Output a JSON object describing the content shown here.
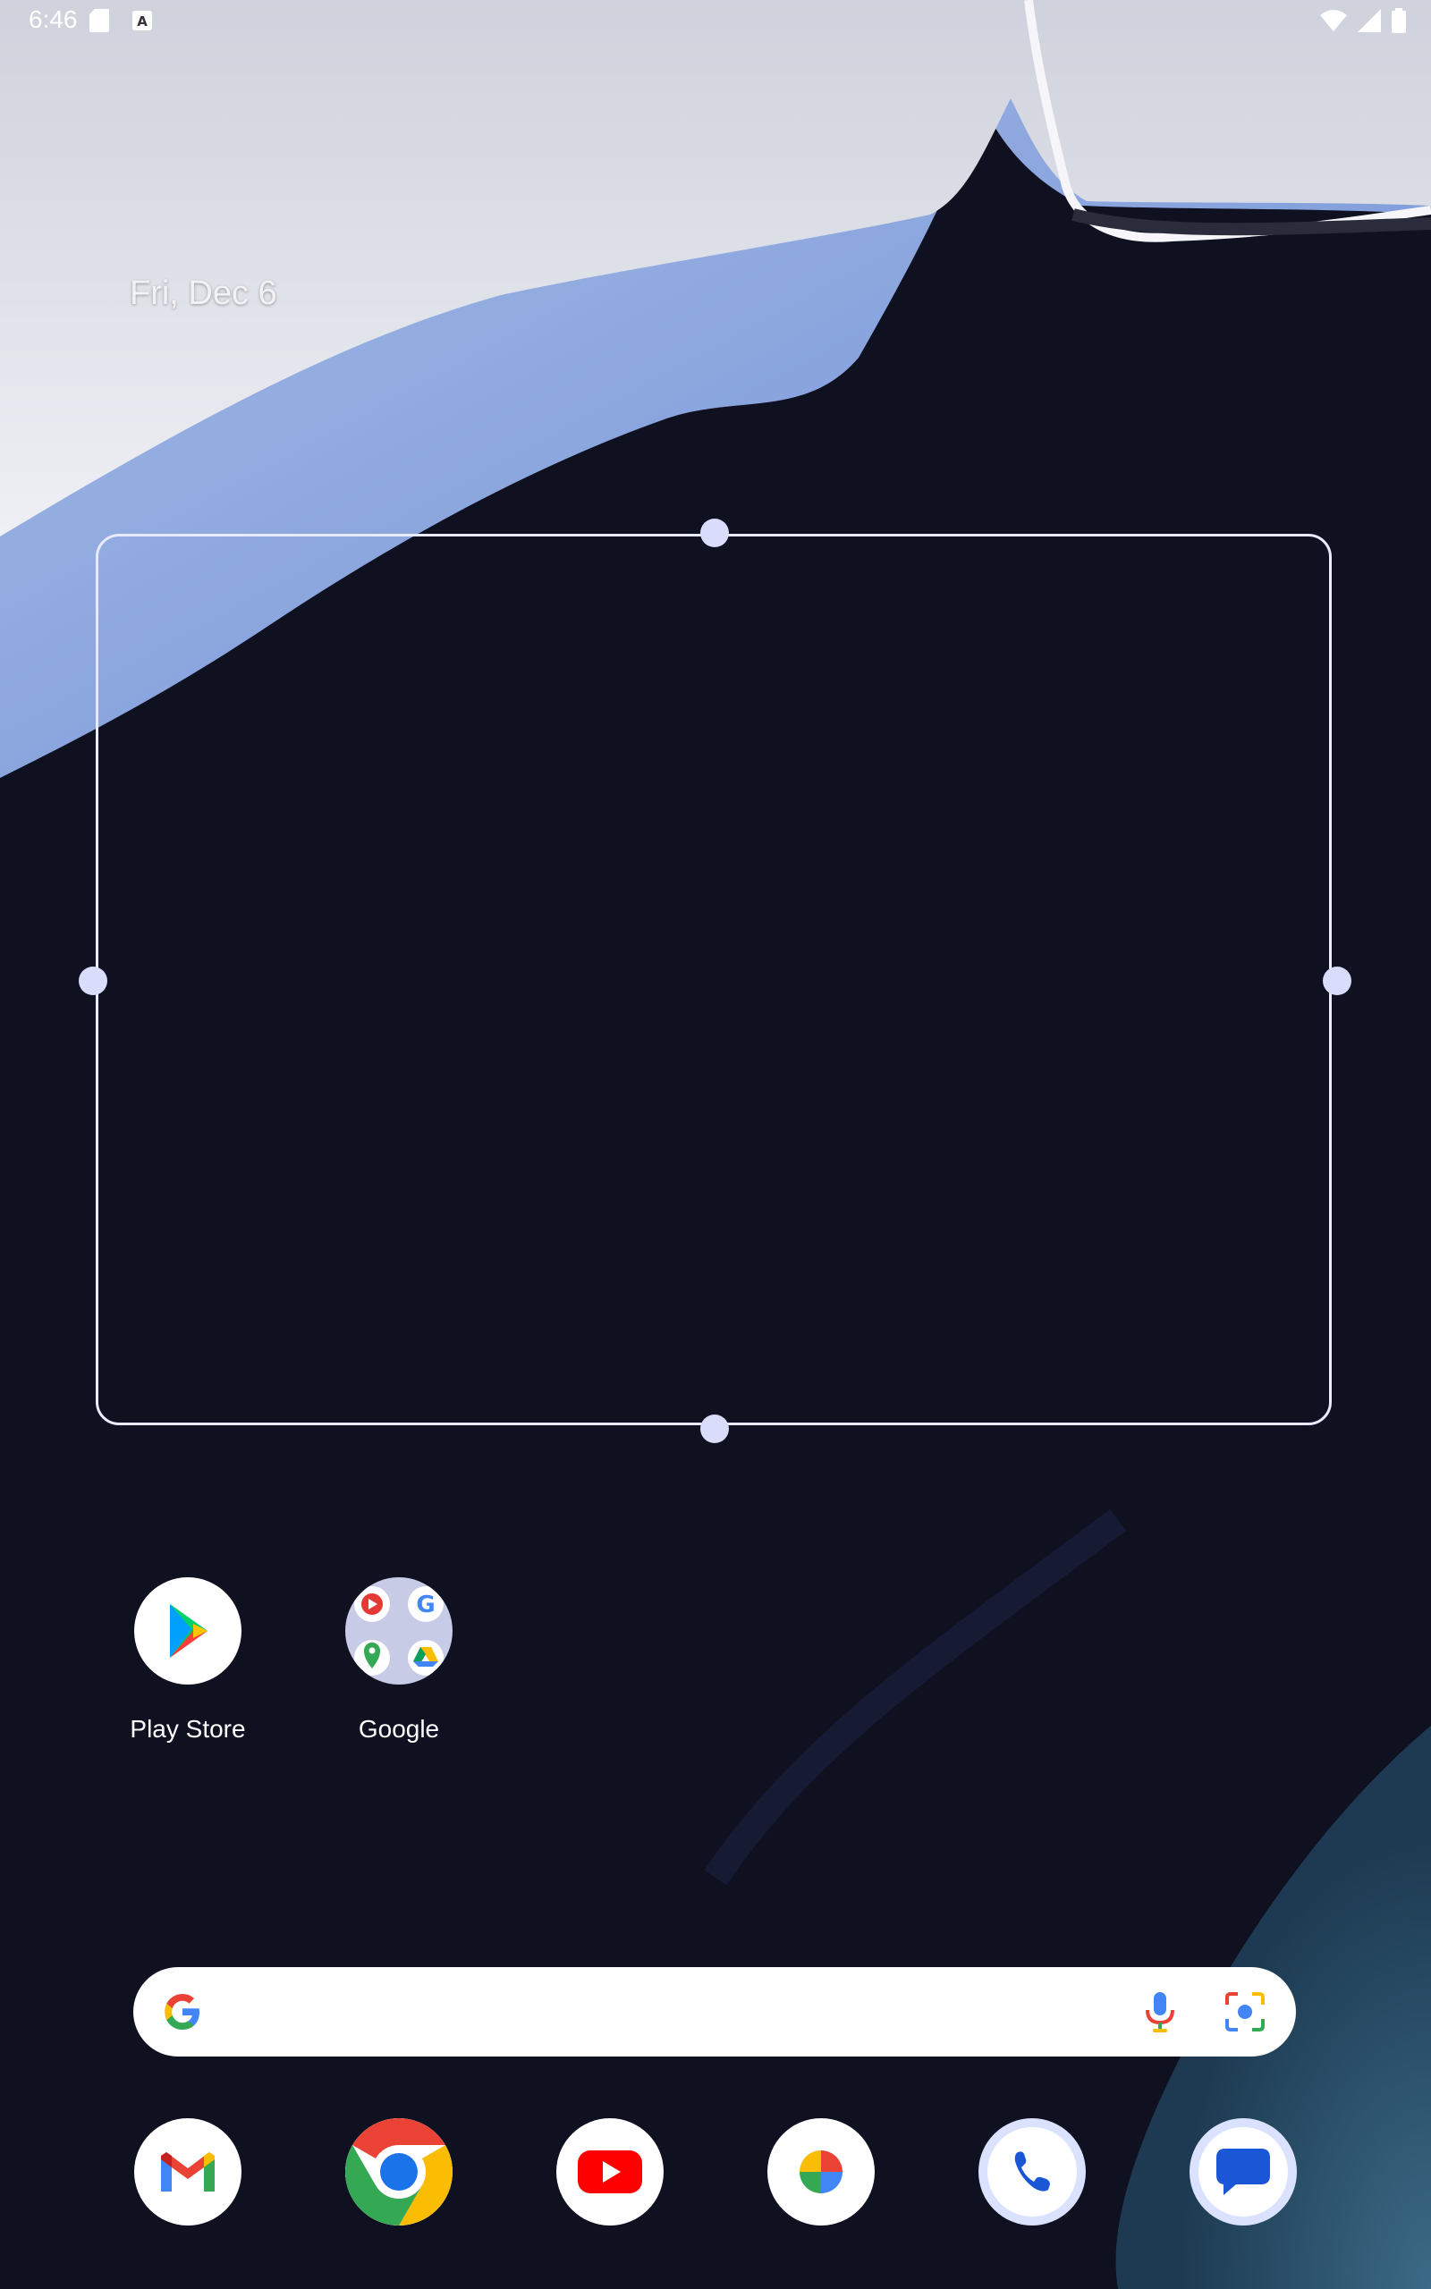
{
  "status_bar": {
    "time": "6:46",
    "icons": [
      "sd-card-icon",
      "a-notification-icon",
      "wifi-icon",
      "cell-signal-icon",
      "battery-icon"
    ]
  },
  "date_widget": {
    "text": "Fri, Dec 6"
  },
  "home_apps": [
    {
      "label": "Play Store",
      "icon": "play-store-icon"
    },
    {
      "label": "Google",
      "icon": "google-folder-icon"
    }
  ],
  "folder_contents": [
    "youtube-music-icon",
    "google-icon",
    "maps-icon",
    "drive-icon"
  ],
  "search_bar": {
    "icons": [
      "google-g-icon",
      "microphone-icon",
      "google-lens-icon"
    ]
  },
  "dock": [
    "gmail-icon",
    "chrome-icon",
    "youtube-icon",
    "photos-icon",
    "phone-icon",
    "messages-icon"
  ],
  "colors": {
    "background": "#0f1020",
    "widget_outline": "#e8ebff",
    "handle": "#d9ddfb",
    "wallpaper_blue": "#7a9ad8"
  }
}
